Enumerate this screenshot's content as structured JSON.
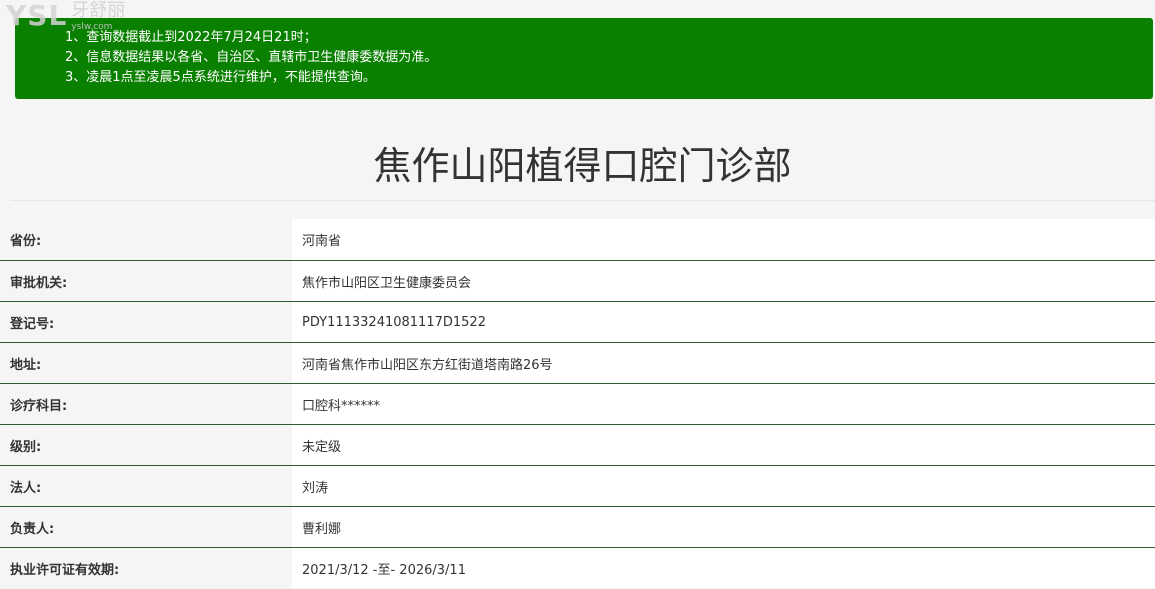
{
  "logo": {
    "main": "YSL",
    "cn": "牙舒丽",
    "url": "yslw.com"
  },
  "notice": {
    "lines": [
      "1、查询数据截止到2022年7月24日21时；",
      "2、信息数据结果以各省、自治区、直辖市卫生健康委数据为准。",
      "3、凌晨1点至凌晨5点系统进行维护，不能提供查询。"
    ],
    "background": "#0a8000"
  },
  "title": "焦作山阳植得口腔门诊部",
  "rows": [
    {
      "label": "省份:",
      "value": "河南省"
    },
    {
      "label": "审批机关:",
      "value": "焦作市山阳区卫生健康委员会"
    },
    {
      "label": "登记号:",
      "value": "PDY11133241081117D1522"
    },
    {
      "label": "地址:",
      "value": "河南省焦作市山阳区东方红街道塔南路26号"
    },
    {
      "label": "诊疗科目:",
      "value": "口腔科******"
    },
    {
      "label": "级别:",
      "value": "未定级"
    },
    {
      "label": "法人:",
      "value": "刘涛"
    },
    {
      "label": "负责人:",
      "value": "曹利娜"
    },
    {
      "label": "执业许可证有效期:",
      "value": "2021/3/12 -至- 2026/3/11"
    }
  ]
}
